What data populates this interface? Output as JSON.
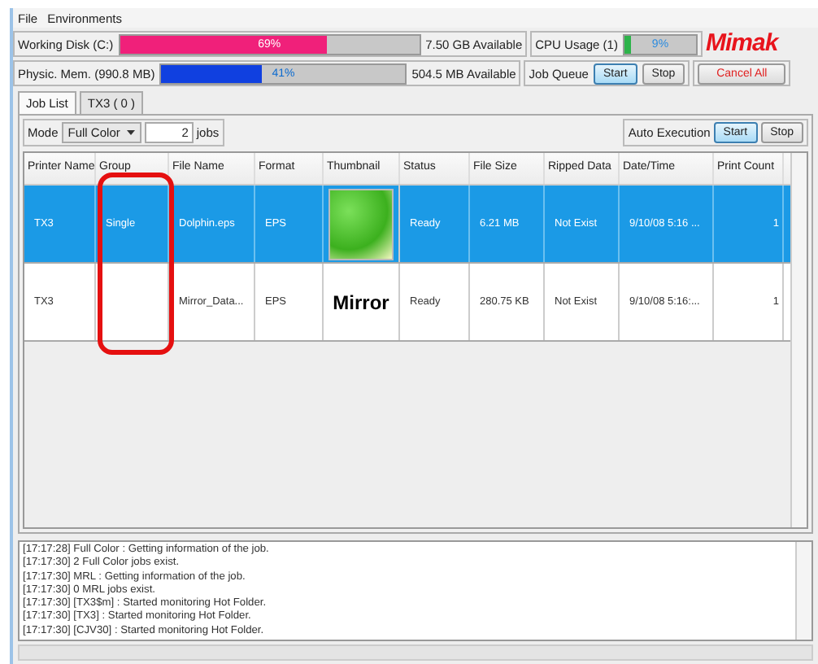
{
  "menu": [
    "File",
    "Environments"
  ],
  "resources": [
    {
      "label": "Working Disk (C:)",
      "level": 0.69,
      "reading": "69%",
      "available": "7.50 GB Available",
      "color": "#f0207a"
    },
    {
      "label": "Physic. Mem. (990.8 MB)",
      "level": 0.41,
      "reading": "41%",
      "available": "504.5 MB Available",
      "color": "#1040e0"
    }
  ],
  "cpu": {
    "label": "CPU Usage (1)",
    "level": 0.09,
    "reading": "9%"
  },
  "logo": "Mimak",
  "job_queue": {
    "label": "Job Queue",
    "buttons": [
      {
        "label": "Start",
        "active": true
      },
      {
        "label": "Stop",
        "active": false
      }
    ]
  },
  "cancel_all": "Cancel All",
  "tabs": [
    {
      "label": "Job List",
      "selected": true
    },
    {
      "label": "TX3 ( 0 )",
      "selected": false
    }
  ],
  "mode": {
    "label": "Mode",
    "value": "Full Color",
    "count": "2",
    "unit": "jobs"
  },
  "auto_execution": {
    "label": "Auto Execution",
    "buttons": [
      {
        "label": "Start",
        "active": true
      },
      {
        "label": "Stop",
        "active": false
      }
    ]
  },
  "table": {
    "columns": [
      "Printer Name",
      "Group",
      "File Name",
      "Format",
      "Thumbnail",
      "Status",
      "File Size",
      "Ripped Data",
      "Date/Time",
      "Print Count"
    ],
    "rows": [
      {
        "selected": true,
        "cells": [
          "TX3",
          "Single",
          "Dolphin.eps",
          "EPS",
          null,
          "Ready",
          "6.21 MB",
          "Not Exist",
          "9/10/08 5:16 ...",
          "1"
        ],
        "thumbnail": {
          "kind": "photo"
        }
      },
      {
        "selected": false,
        "cells": [
          "TX3",
          "",
          "Mirror_Data...",
          "EPS",
          null,
          "Ready",
          "280.75 KB",
          "Not Exist",
          "9/10/08 5:16:...",
          "1"
        ],
        "thumbnail": {
          "kind": "text",
          "text": "Mirror"
        }
      }
    ]
  },
  "log": [
    "[17:17:28] Full Color : Getting information of the job.",
    "[17:17:30] 2 Full Color jobs exist.",
    "[17:17:30] MRL : Getting information of the job.",
    "[17:17:30] 0 MRL jobs exist.",
    "[17:17:30] [TX3$m] : Started monitoring Hot Folder.",
    "[17:17:30] [TX3] : Started monitoring Hot Folder.",
    "[17:17:30] [CJV30] : Started monitoring Hot Folder."
  ]
}
